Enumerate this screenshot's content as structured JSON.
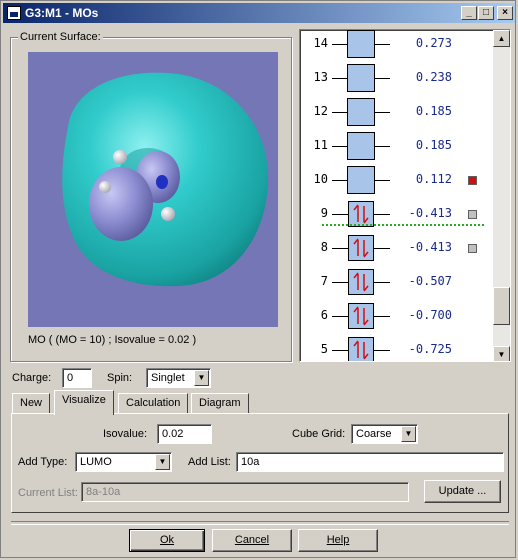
{
  "window": {
    "title": "G3:M1 - MOs",
    "controls": {
      "minimize": "_",
      "maximize": "□",
      "close": "×"
    }
  },
  "surface": {
    "group_label": "Current Surface:",
    "caption": "MO ( (MO = 10) ; Isovalue = 0.02 )",
    "background_color": "#7476b6",
    "isosurface_color": "#2ec4c4",
    "lobe_color": "#8a8ad0"
  },
  "orbitals": [
    {
      "number": "14",
      "energy": "0.273",
      "occupied": false,
      "marker": ""
    },
    {
      "number": "13",
      "energy": "0.238",
      "occupied": false,
      "marker": ""
    },
    {
      "number": "12",
      "energy": "0.185",
      "occupied": false,
      "marker": ""
    },
    {
      "number": "11",
      "energy": "0.185",
      "occupied": false,
      "marker": ""
    },
    {
      "number": "10",
      "energy": "0.112",
      "occupied": false,
      "marker": "red"
    },
    {
      "number": "9",
      "energy": "-0.413",
      "occupied": true,
      "marker": "gray"
    },
    {
      "number": "8",
      "energy": "-0.413",
      "occupied": true,
      "marker": "gray"
    },
    {
      "number": "7",
      "energy": "-0.507",
      "occupied": true,
      "marker": ""
    },
    {
      "number": "6",
      "energy": "-0.700",
      "occupied": true,
      "marker": ""
    },
    {
      "number": "5",
      "energy": "-0.725",
      "occupied": true,
      "marker": ""
    }
  ],
  "colors": {
    "selected_marker": "#d01010",
    "listed_marker": "#c0c0c0",
    "homo_lumo_separator": "#22b022",
    "electron_arrow": "#d01010",
    "energy_text": "#1a2a8a"
  },
  "controls": {
    "charge_label": "Charge:",
    "charge_value": "0",
    "spin_label": "Spin:",
    "spin_value": "Singlet"
  },
  "tabs": [
    {
      "label": "New",
      "active": false
    },
    {
      "label": "Visualize",
      "active": true
    },
    {
      "label": "Calculation",
      "active": false
    },
    {
      "label": "Diagram",
      "active": false
    }
  ],
  "visualize": {
    "isovalue_label": "Isovalue:",
    "isovalue_value": "0.02",
    "cube_grid_label": "Cube Grid:",
    "cube_grid_value": "Coarse",
    "add_type_label": "Add Type:",
    "add_type_value": "LUMO",
    "add_list_label": "Add List:",
    "add_list_value": "10a",
    "current_list_label": "Current List:",
    "current_list_value": "8a-10a",
    "update_button": "Update ..."
  },
  "footer": {
    "ok_button": "Ok",
    "cancel_button": "Cancel",
    "help_button": "Help"
  }
}
